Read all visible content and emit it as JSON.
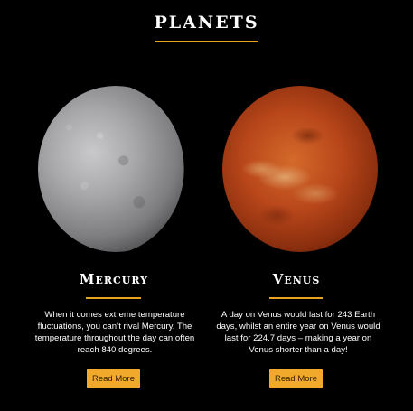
{
  "section": {
    "title": "PLANETS"
  },
  "colors": {
    "accent": "#e9a21c",
    "button": "#f0a92b",
    "background": "#000000",
    "text": "#ffffff"
  },
  "planets": [
    {
      "name": "Mercury",
      "description": "When it comes extreme temperature fluctuations, you can’t rival Mercury. The temperature throughout the day can often reach 840 degrees.",
      "button_label": "Read More"
    },
    {
      "name": "Venus",
      "description": "A day on Venus would last for 243 Earth days, whilst an entire year on Venus would last for 224.7 days – making a year on Venus shorter than a day!",
      "button_label": "Read More"
    }
  ]
}
